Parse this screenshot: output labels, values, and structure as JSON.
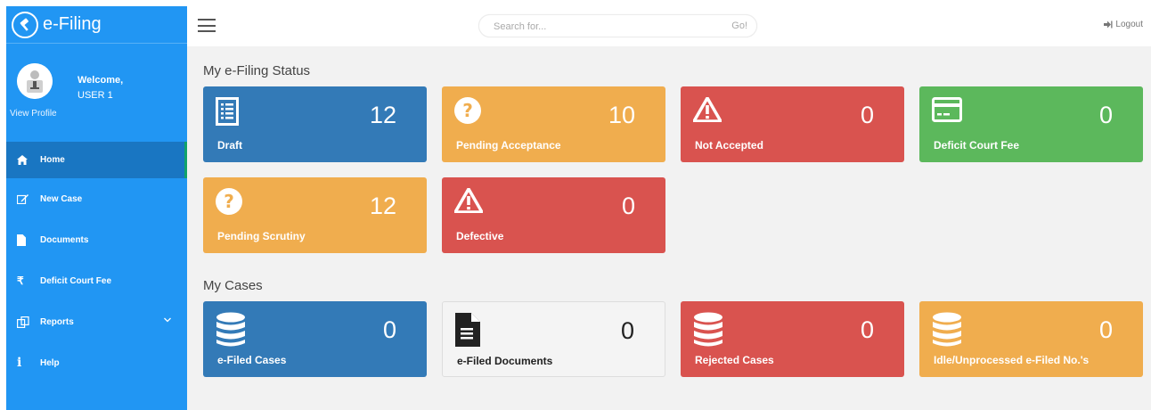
{
  "brand": {
    "title": "e-Filing",
    "logo_icon": "gavel-icon"
  },
  "profile": {
    "welcome": "Welcome,",
    "user": "USER 1",
    "view_profile": "View Profile"
  },
  "sidebar": {
    "items": [
      {
        "label": "Home",
        "icon": "home-icon"
      },
      {
        "label": "New Case",
        "icon": "edit-icon"
      },
      {
        "label": "Documents",
        "icon": "file-icon"
      },
      {
        "label": "Deficit Court Fee",
        "icon": "rupee-icon"
      },
      {
        "label": "Reports",
        "icon": "copy-icon"
      },
      {
        "label": "Help",
        "icon": "info-icon"
      }
    ]
  },
  "topbar": {
    "search_placeholder": "Search for...",
    "go_label": "Go!",
    "logout_label": "Logout"
  },
  "sections": {
    "status_title": "My e-Filing Status",
    "cases_title": "My Cases"
  },
  "status_cards": [
    {
      "label": "Draft",
      "count": "12",
      "color": "#337ab7",
      "icon": "list-icon"
    },
    {
      "label": "Pending Acceptance",
      "count": "10",
      "color": "#f0ad4e",
      "icon": "question-icon"
    },
    {
      "label": "Not Accepted",
      "count": "0",
      "color": "#d9534f",
      "icon": "warning-icon"
    },
    {
      "label": "Deficit Court Fee",
      "count": "0",
      "color": "#5cb85c",
      "icon": "credit-card-icon"
    },
    {
      "label": "Pending Scrutiny",
      "count": "12",
      "color": "#f0ad4e",
      "icon": "question-icon"
    },
    {
      "label": "Defective",
      "count": "0",
      "color": "#d9534f",
      "icon": "warning-icon"
    }
  ],
  "case_cards": [
    {
      "label": "e-Filed Cases",
      "count": "0",
      "color": "#337ab7",
      "icon": "database-icon"
    },
    {
      "label": "e-Filed Documents",
      "count": "0",
      "color": "#f4f4f4",
      "icon": "document-icon"
    },
    {
      "label": "Rejected Cases",
      "count": "0",
      "color": "#d9534f",
      "icon": "database-icon"
    },
    {
      "label": "Idle/Unprocessed e-Filed No.'s",
      "count": "0",
      "color": "#f0ad4e",
      "icon": "database-icon"
    }
  ]
}
